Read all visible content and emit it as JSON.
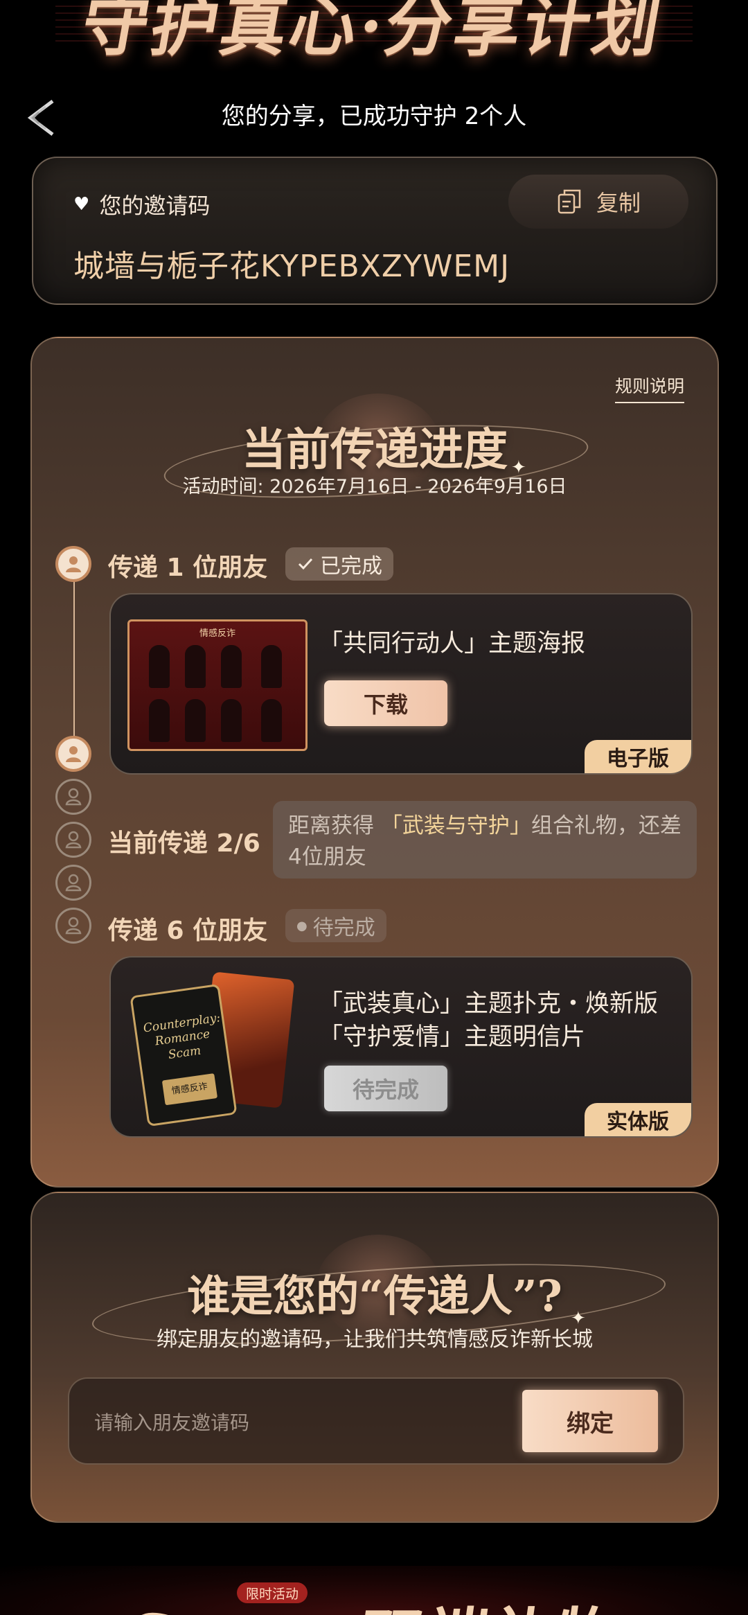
{
  "hero": {
    "title": "守护真心·分享计划"
  },
  "header": {
    "share_status": "您的分享，已成功守护 2个人"
  },
  "invite": {
    "label": "您的邀请码",
    "copy_label": "复制",
    "code": "城墙与栀子花KYPEBXZYWEMJ"
  },
  "progress": {
    "rules_link": "规则说明",
    "title": "当前传递进度",
    "subtitle": "活动时间: 2026年7月16日 - 2026年9月16日",
    "step1": {
      "label": "传递 1 位朋友",
      "badge": "已完成",
      "reward_title": "「共同行动人」主题海报",
      "button": "下载",
      "edition": "电子版"
    },
    "relay": {
      "status": "当前传递 2/6",
      "note_prefix": "距离获得 ",
      "note_highlight": "「武装与守护」",
      "note_suffix": "组合礼物，还差4位朋友"
    },
    "step6": {
      "label": "传递 6 位朋友",
      "badge": "待完成",
      "reward_line1": "「武装真心」主题扑克・焕新版",
      "reward_line2": "「守护爱情」主题明信片",
      "button": "待完成",
      "edition": "实体版"
    },
    "poster_text": "情感反诈",
    "card_text": "Counterplay: Romance Scam",
    "card_sub": "情感反诈"
  },
  "bind": {
    "title": "谁是您的“传递人”?",
    "subtitle": "绑定朋友的邀请码，让我们共筑情感反诈新长城",
    "placeholder": "请输入朋友邀请码",
    "button": "绑定"
  },
  "steam": {
    "tag": "限时活动",
    "title": "Steam双端礼物"
  },
  "timeline": {
    "completed": 2,
    "total": 6
  },
  "colors": {
    "accent": "#f2cfa1",
    "panel": "#5a4233",
    "highlight": "#f4d59b"
  }
}
